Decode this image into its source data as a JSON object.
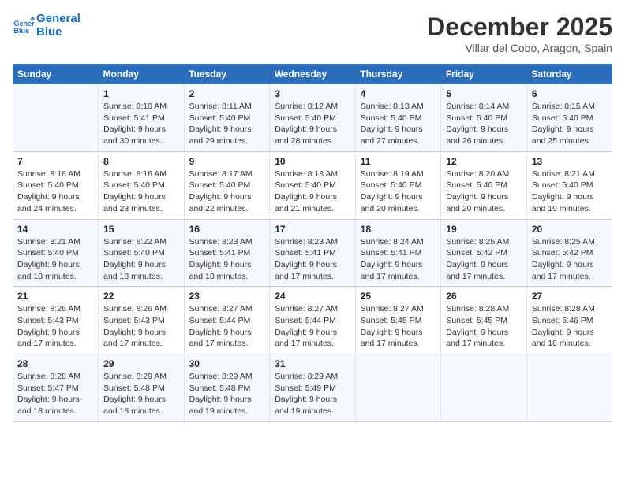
{
  "logo": {
    "line1": "General",
    "line2": "Blue"
  },
  "title": "December 2025",
  "subtitle": "Villar del Cobo, Aragon, Spain",
  "weekdays": [
    "Sunday",
    "Monday",
    "Tuesday",
    "Wednesday",
    "Thursday",
    "Friday",
    "Saturday"
  ],
  "weeks": [
    [
      {
        "day": "",
        "info": ""
      },
      {
        "day": "1",
        "info": "Sunrise: 8:10 AM\nSunset: 5:41 PM\nDaylight: 9 hours\nand 30 minutes."
      },
      {
        "day": "2",
        "info": "Sunrise: 8:11 AM\nSunset: 5:40 PM\nDaylight: 9 hours\nand 29 minutes."
      },
      {
        "day": "3",
        "info": "Sunrise: 8:12 AM\nSunset: 5:40 PM\nDaylight: 9 hours\nand 28 minutes."
      },
      {
        "day": "4",
        "info": "Sunrise: 8:13 AM\nSunset: 5:40 PM\nDaylight: 9 hours\nand 27 minutes."
      },
      {
        "day": "5",
        "info": "Sunrise: 8:14 AM\nSunset: 5:40 PM\nDaylight: 9 hours\nand 26 minutes."
      },
      {
        "day": "6",
        "info": "Sunrise: 8:15 AM\nSunset: 5:40 PM\nDaylight: 9 hours\nand 25 minutes."
      }
    ],
    [
      {
        "day": "7",
        "info": "Sunrise: 8:16 AM\nSunset: 5:40 PM\nDaylight: 9 hours\nand 24 minutes."
      },
      {
        "day": "8",
        "info": "Sunrise: 8:16 AM\nSunset: 5:40 PM\nDaylight: 9 hours\nand 23 minutes."
      },
      {
        "day": "9",
        "info": "Sunrise: 8:17 AM\nSunset: 5:40 PM\nDaylight: 9 hours\nand 22 minutes."
      },
      {
        "day": "10",
        "info": "Sunrise: 8:18 AM\nSunset: 5:40 PM\nDaylight: 9 hours\nand 21 minutes."
      },
      {
        "day": "11",
        "info": "Sunrise: 8:19 AM\nSunset: 5:40 PM\nDaylight: 9 hours\nand 20 minutes."
      },
      {
        "day": "12",
        "info": "Sunrise: 8:20 AM\nSunset: 5:40 PM\nDaylight: 9 hours\nand 20 minutes."
      },
      {
        "day": "13",
        "info": "Sunrise: 8:21 AM\nSunset: 5:40 PM\nDaylight: 9 hours\nand 19 minutes."
      }
    ],
    [
      {
        "day": "14",
        "info": "Sunrise: 8:21 AM\nSunset: 5:40 PM\nDaylight: 9 hours\nand 18 minutes."
      },
      {
        "day": "15",
        "info": "Sunrise: 8:22 AM\nSunset: 5:40 PM\nDaylight: 9 hours\nand 18 minutes."
      },
      {
        "day": "16",
        "info": "Sunrise: 8:23 AM\nSunset: 5:41 PM\nDaylight: 9 hours\nand 18 minutes."
      },
      {
        "day": "17",
        "info": "Sunrise: 8:23 AM\nSunset: 5:41 PM\nDaylight: 9 hours\nand 17 minutes."
      },
      {
        "day": "18",
        "info": "Sunrise: 8:24 AM\nSunset: 5:41 PM\nDaylight: 9 hours\nand 17 minutes."
      },
      {
        "day": "19",
        "info": "Sunrise: 8:25 AM\nSunset: 5:42 PM\nDaylight: 9 hours\nand 17 minutes."
      },
      {
        "day": "20",
        "info": "Sunrise: 8:25 AM\nSunset: 5:42 PM\nDaylight: 9 hours\nand 17 minutes."
      }
    ],
    [
      {
        "day": "21",
        "info": "Sunrise: 8:26 AM\nSunset: 5:43 PM\nDaylight: 9 hours\nand 17 minutes."
      },
      {
        "day": "22",
        "info": "Sunrise: 8:26 AM\nSunset: 5:43 PM\nDaylight: 9 hours\nand 17 minutes."
      },
      {
        "day": "23",
        "info": "Sunrise: 8:27 AM\nSunset: 5:44 PM\nDaylight: 9 hours\nand 17 minutes."
      },
      {
        "day": "24",
        "info": "Sunrise: 8:27 AM\nSunset: 5:44 PM\nDaylight: 9 hours\nand 17 minutes."
      },
      {
        "day": "25",
        "info": "Sunrise: 8:27 AM\nSunset: 5:45 PM\nDaylight: 9 hours\nand 17 minutes."
      },
      {
        "day": "26",
        "info": "Sunrise: 8:28 AM\nSunset: 5:45 PM\nDaylight: 9 hours\nand 17 minutes."
      },
      {
        "day": "27",
        "info": "Sunrise: 8:28 AM\nSunset: 5:46 PM\nDaylight: 9 hours\nand 18 minutes."
      }
    ],
    [
      {
        "day": "28",
        "info": "Sunrise: 8:28 AM\nSunset: 5:47 PM\nDaylight: 9 hours\nand 18 minutes."
      },
      {
        "day": "29",
        "info": "Sunrise: 8:29 AM\nSunset: 5:48 PM\nDaylight: 9 hours\nand 18 minutes."
      },
      {
        "day": "30",
        "info": "Sunrise: 8:29 AM\nSunset: 5:48 PM\nDaylight: 9 hours\nand 19 minutes."
      },
      {
        "day": "31",
        "info": "Sunrise: 8:29 AM\nSunset: 5:49 PM\nDaylight: 9 hours\nand 19 minutes."
      },
      {
        "day": "",
        "info": ""
      },
      {
        "day": "",
        "info": ""
      },
      {
        "day": "",
        "info": ""
      }
    ]
  ]
}
